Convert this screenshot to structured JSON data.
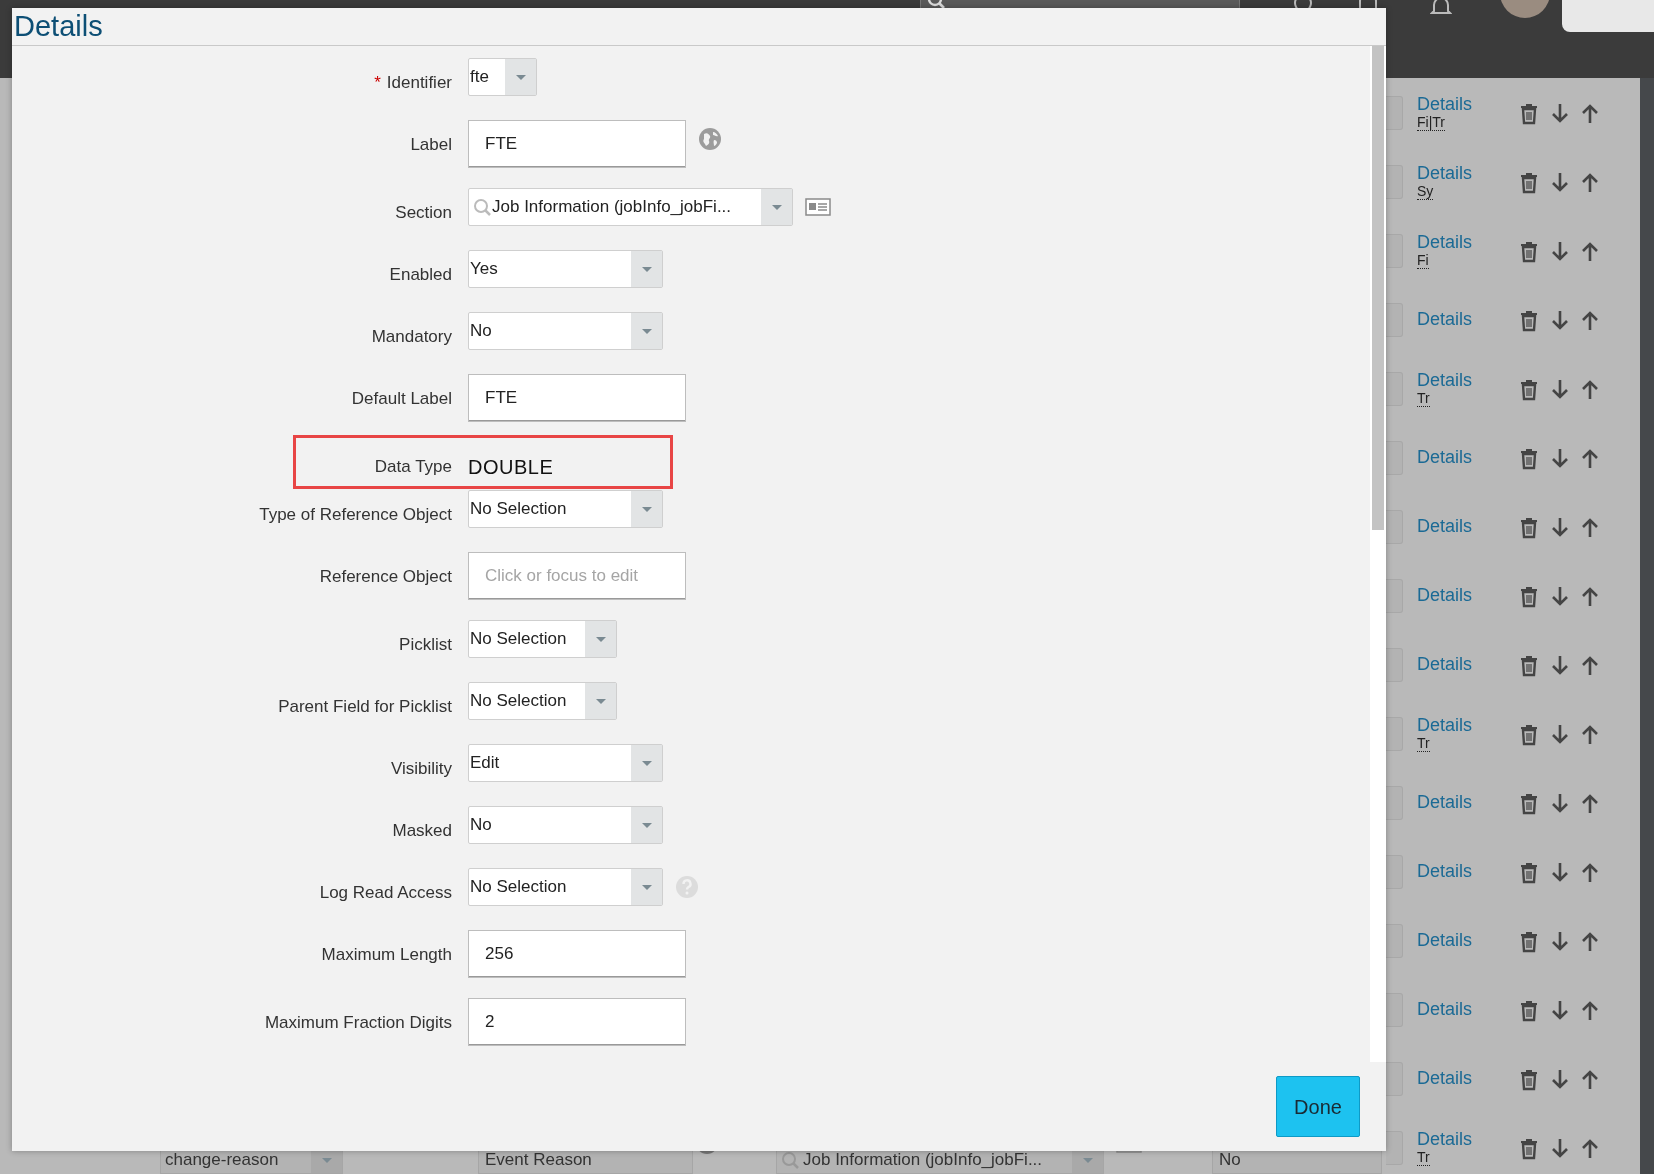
{
  "table": {
    "rows": [
      {
        "link": "Details",
        "tag": "Fi|Tr"
      },
      {
        "link": "Details",
        "tag": "Sy"
      },
      {
        "link": "Details",
        "tag": "Fi"
      },
      {
        "link": "Details"
      },
      {
        "link": "Details",
        "tag": "Tr"
      },
      {
        "link": "Details"
      },
      {
        "link": "Details"
      },
      {
        "link": "Details"
      },
      {
        "link": "Details"
      },
      {
        "link": "Details",
        "tag": "Tr"
      },
      {
        "link": "Details"
      },
      {
        "link": "Details"
      },
      {
        "link": "Details"
      },
      {
        "link": "Details"
      },
      {
        "link": "Details"
      },
      {
        "link": "Details",
        "tag": "Tr",
        "cells": {
          "identifier": "change-reason",
          "label": "Event Reason",
          "section": "Job Information (jobInfo_jobFi...",
          "enabled": "No"
        }
      }
    ]
  },
  "dialog": {
    "title": "Details",
    "fields": [
      {
        "label": "Identifier",
        "marker": "*",
        "kind": "combo",
        "value": "fte"
      },
      {
        "label": "Label",
        "kind": "input",
        "value": "FTE"
      },
      {
        "label": "Section",
        "kind": "search",
        "value": "Job Information (jobInfo_jobFi..."
      },
      {
        "label": "Enabled",
        "kind": "select",
        "value": "Yes"
      },
      {
        "label": "Mandatory",
        "kind": "select",
        "value": "No"
      },
      {
        "label": "Default Label",
        "kind": "input",
        "value": "FTE"
      },
      {
        "label": "Data Type",
        "kind": "text",
        "value": "DOUBLE",
        "highlighted": true
      },
      {
        "label": "Type of Reference Object",
        "kind": "select",
        "value": "No Selection"
      },
      {
        "label": "Reference Object",
        "kind": "input",
        "placeholder": "Click or focus to edit"
      },
      {
        "label": "Picklist",
        "kind": "narrow",
        "value": "No Selection"
      },
      {
        "label": "Parent Field for Picklist",
        "kind": "narrow",
        "value": "No Selection"
      },
      {
        "label": "Visibility",
        "kind": "select",
        "value": "Edit"
      },
      {
        "label": "Masked",
        "kind": "select",
        "value": "No"
      },
      {
        "label": "Log Read Access",
        "kind": "select",
        "value": "No Selection"
      },
      {
        "label": "Maximum Length",
        "kind": "input",
        "value": "256"
      },
      {
        "label": "Maximum Fraction Digits",
        "kind": "input",
        "value": "2"
      }
    ],
    "button": "Done"
  }
}
